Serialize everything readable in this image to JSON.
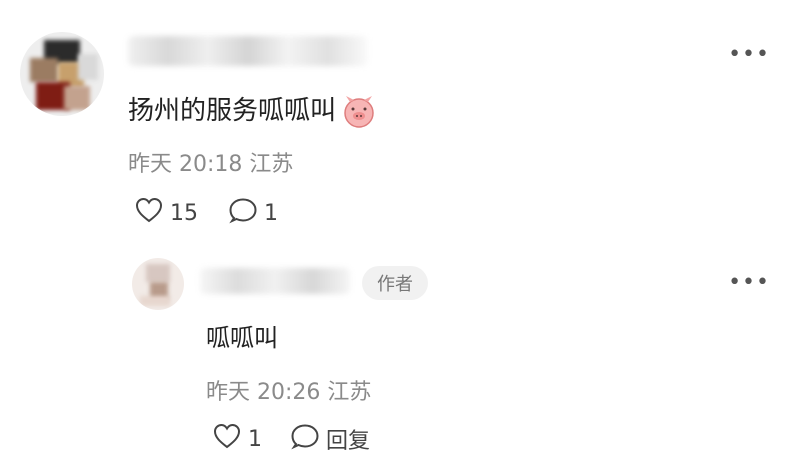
{
  "comment": {
    "text": "扬州的服务呱呱叫",
    "time": "昨天 20:18",
    "location": "江苏",
    "likes": "15",
    "replies": "1"
  },
  "reply": {
    "author_badge": "作者",
    "text": "呱呱叫",
    "time": "昨天 20:26",
    "location": "江苏",
    "likes": "1",
    "reply_label": "回复"
  },
  "icons": {
    "more": "more-icon",
    "heart": "heart-icon",
    "comment": "comment-icon",
    "emoji": "pig-emoji-icon"
  }
}
